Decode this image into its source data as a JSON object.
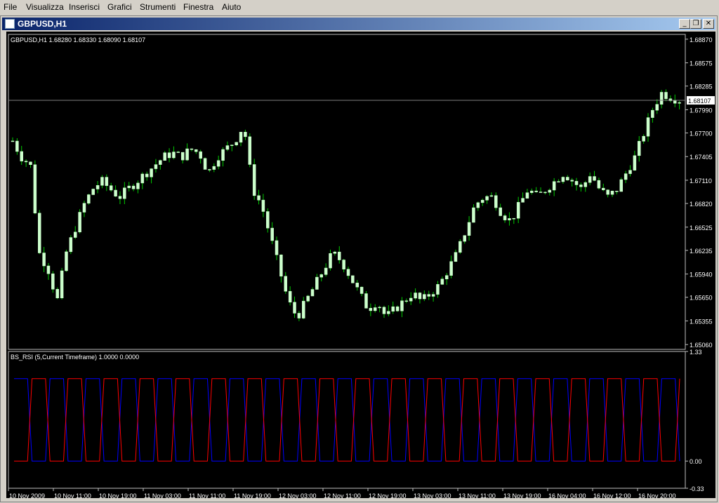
{
  "menu": [
    "File",
    "Visualizza",
    "Inserisci",
    "Grafici",
    "Strumenti",
    "Finestra",
    "Aiuto"
  ],
  "window": {
    "title": "GBPUSD,H1",
    "minimize": "_",
    "restore": "❐",
    "close": "✕"
  },
  "colors": {
    "background": "#000000",
    "candle": "#ccffcc",
    "wick": "#00cc00",
    "grid_text": "#ffffff",
    "rsi_blue": "#0000ff",
    "rsi_red": "#ff0000",
    "price_line": "#808080"
  },
  "main_chart": {
    "symbol_info": "GBPUSD,H1  1.68280 1.68330 1.68090 1.68107",
    "current_price_label": "1.68107",
    "current_price": 1.68107,
    "y_axis_labels": [
      "1.68870",
      "1.68575",
      "1.68285",
      "1.67990",
      "1.67700",
      "1.67405",
      "1.67110",
      "1.66820",
      "1.66525",
      "1.66235",
      "1.65940",
      "1.65650",
      "1.65355",
      "1.65060"
    ],
    "ylim": [
      1.65,
      1.6893
    ]
  },
  "indicator": {
    "label": "BS_RSI (5,Current Timeframe) 1.0000 0.0000",
    "y_axis_labels": [
      "1.33",
      "0.00",
      "-0.33"
    ],
    "ylim": [
      -0.33,
      1.33
    ]
  },
  "x_axis_labels": [
    "10 Nov 2009",
    "10 Nov 11:00",
    "10 Nov 19:00",
    "11 Nov 03:00",
    "11 Nov 11:00",
    "11 Nov 19:00",
    "12 Nov 03:00",
    "12 Nov 11:00",
    "12 Nov 19:00",
    "13 Nov 03:00",
    "13 Nov 11:00",
    "13 Nov 19:00",
    "16 Nov 04:00",
    "16 Nov 12:00",
    "16 Nov 20:00"
  ],
  "chart_data": {
    "type": "candlestick",
    "ylim": [
      1.65,
      1.6893
    ],
    "close_series": [
      1.676,
      1.674,
      1.673,
      1.662,
      1.66,
      1.656,
      1.662,
      1.665,
      1.668,
      1.67,
      1.671,
      1.67,
      1.669,
      1.67,
      1.671,
      1.672,
      1.673,
      1.674,
      1.6745,
      1.674,
      1.675,
      1.6745,
      1.672,
      1.674,
      1.675,
      1.676,
      1.678,
      1.67,
      1.668,
      1.664,
      1.66,
      1.656,
      1.654,
      1.656,
      1.658,
      1.66,
      1.662,
      1.661,
      1.659,
      1.657,
      1.655,
      1.656,
      1.654,
      1.655,
      1.656,
      1.657,
      1.656,
      1.657,
      1.658,
      1.66,
      1.662,
      1.665,
      1.668,
      1.669,
      1.669,
      1.667,
      1.666,
      1.668,
      1.67,
      1.669,
      1.67,
      1.671,
      1.672,
      1.671,
      1.67,
      1.672,
      1.67,
      1.669,
      1.67,
      1.672,
      1.674,
      1.677,
      1.68,
      1.682,
      1.6815,
      1.6811
    ],
    "bs_rsi_blue": [
      1,
      0,
      1,
      0,
      1,
      0,
      1,
      0,
      1,
      0,
      1,
      0,
      1,
      0,
      1,
      0,
      1,
      0,
      1,
      0,
      1,
      0,
      1,
      0,
      1,
      0,
      1,
      0,
      1,
      0,
      1,
      0,
      1,
      0,
      1,
      0,
      1,
      0
    ],
    "bs_rsi_red": [
      0,
      1,
      0,
      1,
      0,
      1,
      0,
      1,
      0,
      1,
      0,
      1,
      0,
      1,
      0,
      1,
      0,
      1,
      0,
      1,
      0,
      1,
      0,
      1,
      0,
      1,
      0,
      1,
      0,
      1,
      0,
      1,
      0,
      1,
      0,
      1,
      0,
      1
    ]
  }
}
